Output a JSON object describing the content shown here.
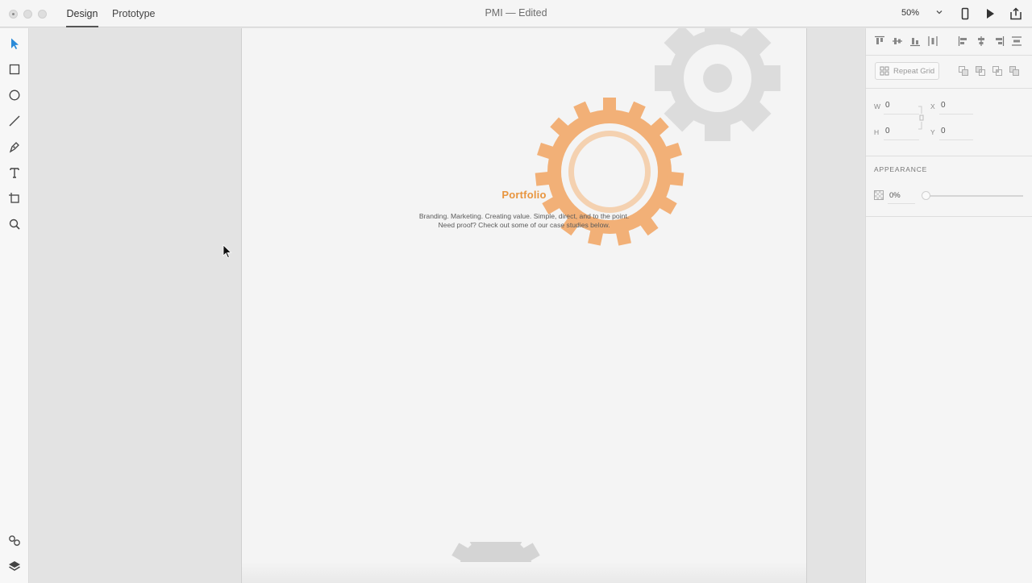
{
  "titlebar": {
    "tabs": [
      {
        "label": "Design",
        "active": true
      },
      {
        "label": "Prototype",
        "active": false
      }
    ],
    "document_title": "PMI — Edited",
    "zoom": "50%",
    "icons": [
      "device-preview-icon",
      "play-icon",
      "share-icon"
    ]
  },
  "tools": [
    "select-arrow-icon",
    "rectangle-icon",
    "ellipse-icon",
    "line-icon",
    "pen-icon",
    "text-icon",
    "artboard-icon",
    "zoom-icon",
    "symbols-icon",
    "layers-icon"
  ],
  "artboard": {
    "title": "Portfolio",
    "subtitle_line1": "Branding. Marketing. Creating value. Simple, direct, and to the point.",
    "subtitle_line2": "Need proof? Check out some of our case studies below.",
    "accent_color": "#f0a463",
    "gear_gray": "#dcdcdc"
  },
  "panel": {
    "repeat_grid_label": "Repeat Grid",
    "w_label": "W",
    "w_value": "0",
    "x_label": "X",
    "x_value": "0",
    "h_label": "H",
    "h_value": "0",
    "y_label": "Y",
    "y_value": "0",
    "appearance_label": "APPEARANCE",
    "opacity_value": "0%"
  }
}
